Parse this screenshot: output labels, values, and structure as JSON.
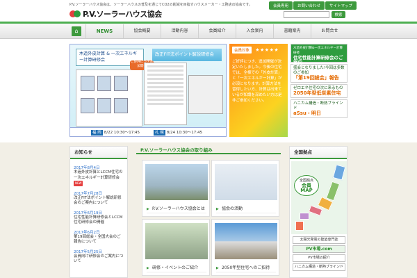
{
  "header": {
    "tagline": "P.V.ソーラーハウス協会は、ソーラーハウスの普及を通じてCO2の削減を目指すハウスメーカー・工務店の協会です。",
    "logo_text": "P.V.ソーラーハウス協会",
    "util_links": [
      "会員専用",
      "お問い合わせ",
      "サイトマップ"
    ],
    "search_placeholder": "",
    "search_button": "検索"
  },
  "nav": {
    "home_icon": "home-icon",
    "items": [
      "NEWS",
      "協会概要",
      "活動内容",
      "会員紹介",
      "入会案内",
      "書籍案内",
      "お問合せ"
    ]
  },
  "hero": {
    "title1": "木造外皮計算 & 一次エネルギー計算研修会",
    "title2": "改正FIT法ポイント解説研修会",
    "badge": "ご好評につき追加開催",
    "date1_label": "福 岡",
    "date1": "8/22 10:30〜17:45",
    "date2_label": "札 幌",
    "date2": "8/24 10:30〜17:45",
    "side_tag": "会員対象",
    "side_stars": "★★★★★",
    "side_text": "ご好評につき、追加開催が決定いたしました。今後の住宅では、全棟での「外皮計算」と「一次エネルギー計算」が必須となります。計算方法を習得したい方、計算は出来ているが知識を深めたい方は是非ご参加ください。"
  },
  "banners": [
    {
      "small": "木造外皮計算&一次エネルギー計算研修",
      "big": "住宅性能計算研修会のご案内"
    },
    {
      "text": "盛会となりました!今回は多数のご参加",
      "hl": "「第19回総会」報告"
    },
    {
      "text": "ゼロエネ住宅の次に来るもの",
      "hl": "2050年型低炭素住宅"
    },
    {
      "text": "ハニカム構造・断熱ブラインド",
      "hl": "aSsu・明日"
    }
  ],
  "news": {
    "title": "お知らせ",
    "items": [
      {
        "date": "2017年8月4日",
        "text": "木造外皮計算とLCCM住宅の一次エネルギー計算研修会",
        "new": "NEW"
      },
      {
        "date": "2017年7月28日",
        "text": "改正FIT法ポイント解説研修会のご案内について",
        "new": ""
      },
      {
        "date": "2017年6月19日",
        "text": "住宅性能計算研修会とLCCM住宅研修会の開催",
        "new": ""
      },
      {
        "date": "2017年6月2日",
        "text": "第19回総会・全国大会のご報告について",
        "new": ""
      },
      {
        "date": "2017年5月25日",
        "text": "会員向け研修会のご案内について",
        "new": ""
      }
    ]
  },
  "main": {
    "title": "P.V.ソーラーハウス協会の取り組み",
    "cards": [
      "P.V.ソーラーハウス協会とは",
      "協会の活動",
      "研修・イベントのご紹介",
      "2050年型住宅へのご招待"
    ]
  },
  "map": {
    "title": "全国拠点",
    "label_top": "全国拠点",
    "label_mid": "会員",
    "label_bottom": "MAP",
    "banners": [
      "太陽光発電の建築専門誌",
      "PV市場.com",
      "PV市場の紹介",
      "ハニカム構造・断熱ブラインド"
    ]
  }
}
